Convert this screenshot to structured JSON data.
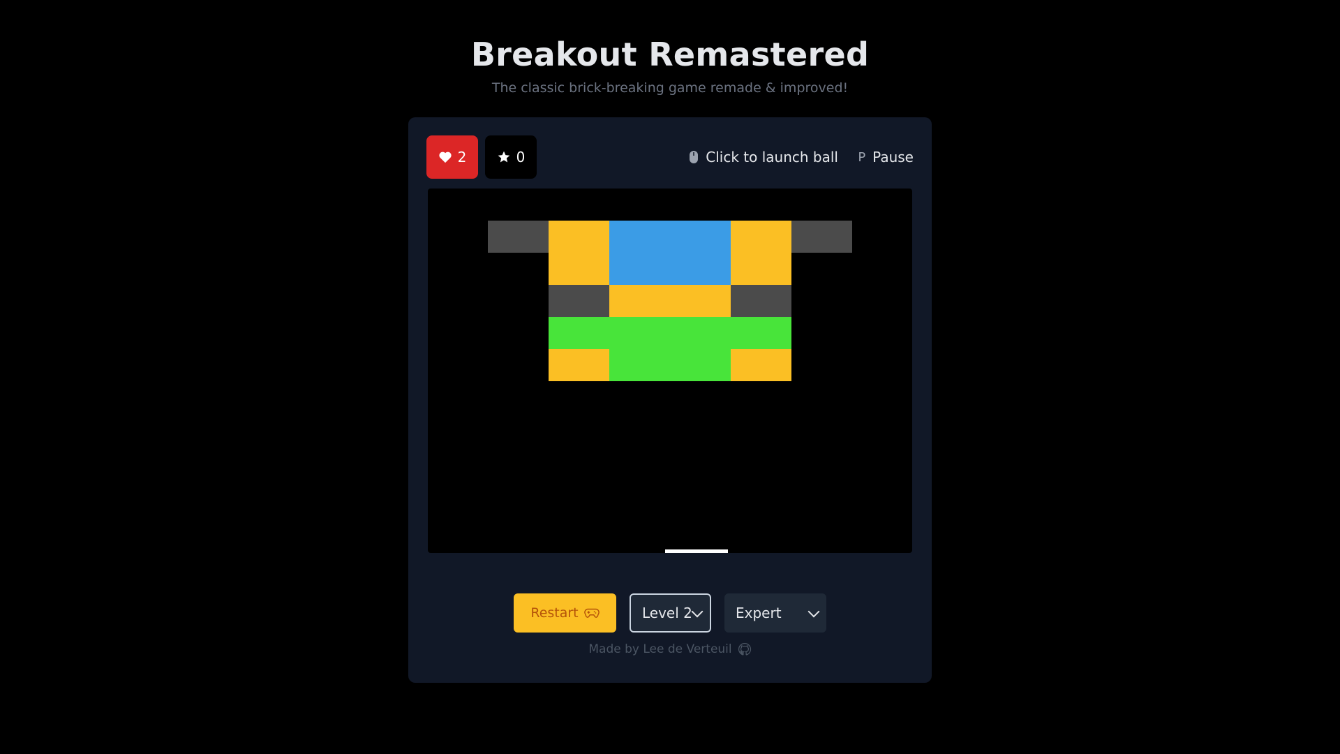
{
  "header": {
    "title": "Breakout Remastered",
    "subtitle": "The classic brick-breaking game remade & improved!"
  },
  "hud": {
    "lives": "2",
    "score": "0",
    "launch_hint": "Click to launch ball",
    "pause_key": "P",
    "pause_label": "Pause"
  },
  "game": {
    "brick_colors": {
      "yellow": "#fbbf24",
      "blue": "#3b9ce6",
      "gray": "#4b4b4b",
      "green": "#48e43a"
    },
    "bricks": [
      [
        "gray",
        "yellow",
        "blue",
        "blue",
        "yellow",
        "gray"
      ],
      [
        null,
        "yellow",
        "blue",
        "blue",
        "yellow",
        null
      ],
      [
        null,
        "gray",
        "yellow",
        "yellow",
        "gray",
        null
      ],
      [
        null,
        "green",
        "green",
        "green",
        "green",
        null
      ],
      [
        null,
        "yellow",
        "green",
        "green",
        "yellow",
        null
      ]
    ]
  },
  "controls": {
    "restart_label": "Restart",
    "level_selected": "Level 2",
    "difficulty_selected": "Expert"
  },
  "footer": {
    "credit": "Made by Lee de Verteuil"
  },
  "icons": {
    "lives": "heart-icon",
    "score": "star-icon",
    "launch": "mouse-icon",
    "restart": "gamepad-icon",
    "footer": "github-icon"
  }
}
